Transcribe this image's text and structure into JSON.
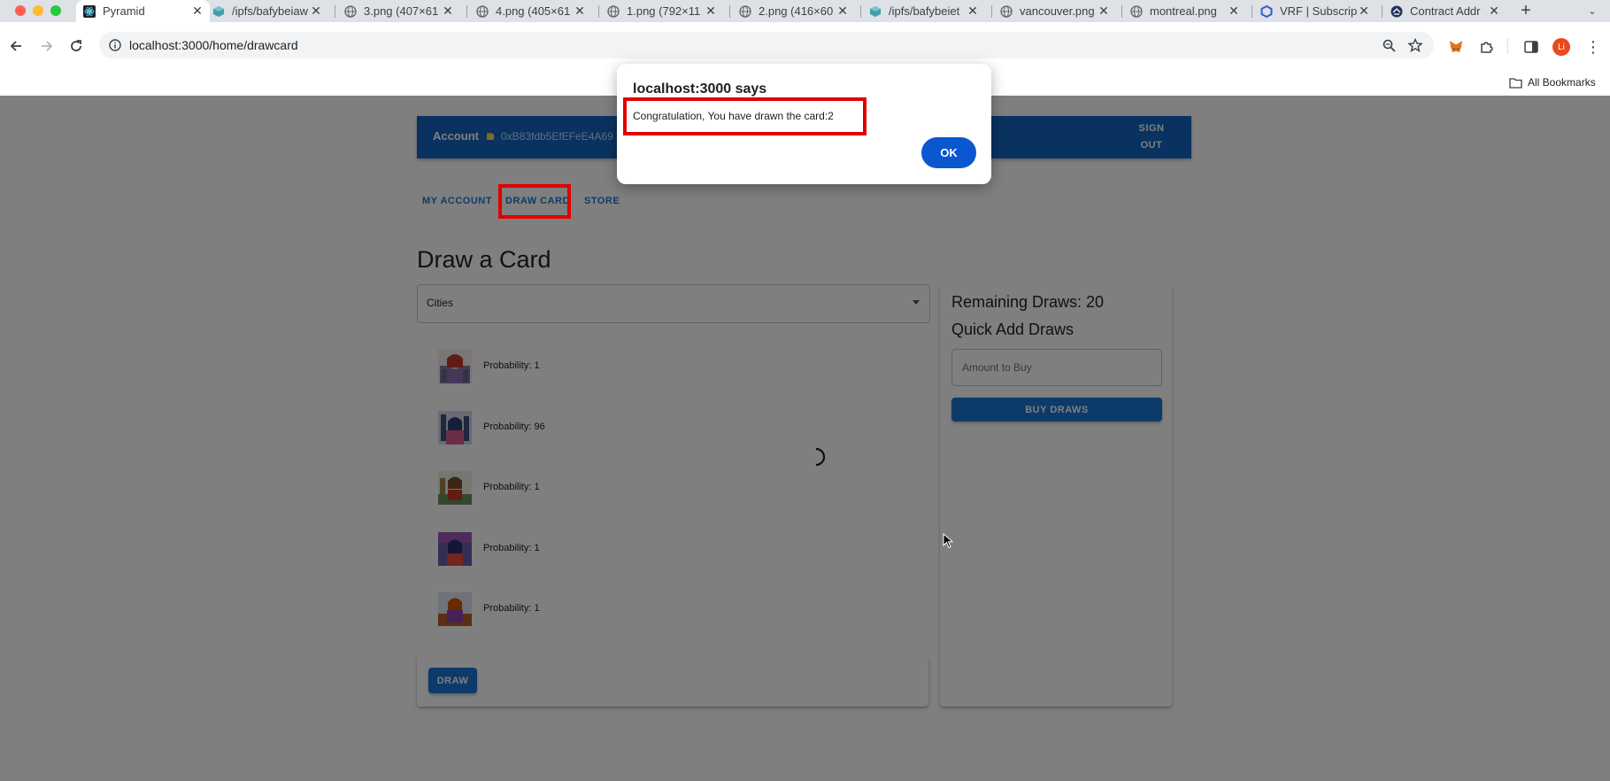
{
  "browser": {
    "tabs": [
      {
        "title": "Pyramid",
        "icon": "react-icon",
        "active": true
      },
      {
        "title": "/ipfs/bafybeiaw",
        "icon": "ipfs-cube-icon"
      },
      {
        "title": "3.png (407×61",
        "icon": "globe-icon"
      },
      {
        "title": "4.png (405×61",
        "icon": "globe-icon"
      },
      {
        "title": "1.png (792×11",
        "icon": "globe-icon"
      },
      {
        "title": "2.png (416×60",
        "icon": "globe-icon"
      },
      {
        "title": "/ipfs/bafybeiet",
        "icon": "ipfs-cube-icon"
      },
      {
        "title": "vancouver.png",
        "icon": "globe-icon"
      },
      {
        "title": "montreal.png",
        "icon": "globe-icon"
      },
      {
        "title": "VRF | Subscrip",
        "icon": "chainlink-hex-icon"
      },
      {
        "title": "Contract Addr",
        "icon": "etherscan-icon"
      }
    ],
    "url": "localhost:3000/home/drawcard",
    "bookmarks_label": "All Bookmarks",
    "profile_initial": "Li"
  },
  "app": {
    "account_label": "Account",
    "account_address": "0xB83fdb5EfEFeE4A69",
    "sign_out": "SIGN OUT",
    "nav": [
      "MY ACCOUNT",
      "DRAW CARD",
      "STORE"
    ],
    "title": "Draw a Card",
    "category_selected": "Cities",
    "cards": [
      {
        "probability_text": "Probability: 1"
      },
      {
        "probability_text": "Probability: 96"
      },
      {
        "probability_text": "Probability: 1"
      },
      {
        "probability_text": "Probability: 1"
      },
      {
        "probability_text": "Probability: 1"
      }
    ],
    "draw_button": "DRAW",
    "remaining_draws": "Remaining Draws: 20",
    "quick_add_title": "Quick Add Draws",
    "amount_placeholder": "Amount to Buy",
    "buy_button": "BUY DRAWS"
  },
  "dialog": {
    "origin": "localhost:3000 says",
    "message": "Congratulation, You have drawn the card:2",
    "ok": "OK"
  },
  "colors": {
    "app_bar": "#1565c0",
    "primary": "#1976d2",
    "highlight": "#e00000",
    "dialog_ok": "#0b57d0"
  }
}
